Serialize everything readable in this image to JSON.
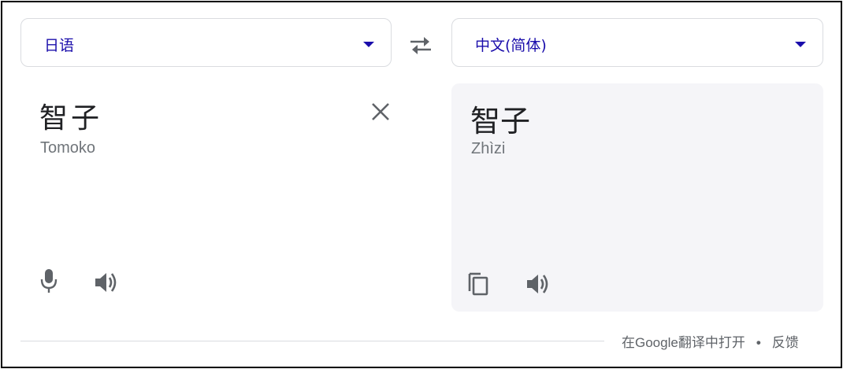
{
  "source": {
    "language": "日语",
    "text": "智子",
    "transliteration": "Tomoko"
  },
  "target": {
    "language": "中文(简体)",
    "text": "智子",
    "transliteration": "Zhìzi"
  },
  "footer": {
    "open_link": "在Google翻译中打开",
    "separator": "•",
    "feedback_link": "反馈"
  },
  "icons": {
    "swap": "swap-icon",
    "clear": "close-icon",
    "mic": "microphone-icon",
    "speaker": "speaker-icon",
    "copy": "copy-icon"
  },
  "colors": {
    "accent": "#1a0dab",
    "icon": "#5f6368",
    "target_panel_bg": "#f5f5f8",
    "border": "#dadce0"
  }
}
